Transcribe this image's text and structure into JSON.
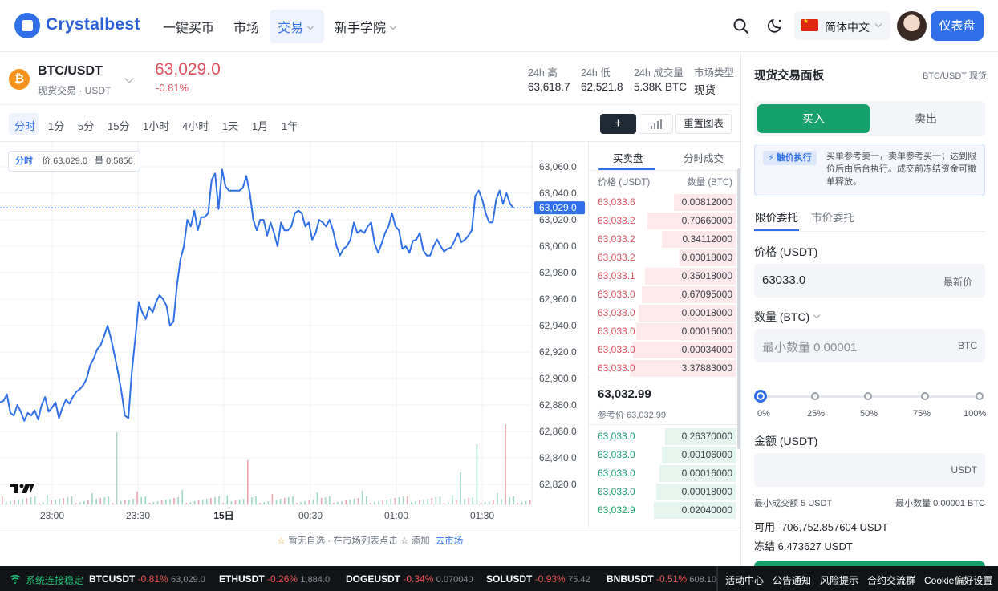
{
  "header": {
    "brand": "Crystalbest",
    "nav": [
      "一键买币",
      "市场",
      "交易",
      "新手学院"
    ],
    "language": "简体中文",
    "dashboard_label": "仪表盘"
  },
  "ticker": {
    "pair": "BTC/USDT",
    "sub": "现货交易 · USDT",
    "price": "63,029.0",
    "change": "-0.81%",
    "stats": [
      {
        "label": "24h 高",
        "value": "63,618.7"
      },
      {
        "label": "24h 低",
        "value": "62,521.8"
      },
      {
        "label": "24h 成交量",
        "value": "5.38K BTC"
      },
      {
        "label": "市场类型",
        "value": "现货"
      }
    ]
  },
  "toolbar": {
    "timeframes": [
      "分时",
      "1分",
      "5分",
      "15分",
      "1小时",
      "4小时",
      "1天",
      "1月",
      "1年"
    ],
    "active": "分时",
    "plus": "+",
    "reset": "重置图表"
  },
  "chart_info": {
    "mode": "分时",
    "price_label": "价",
    "price": "63,029.0",
    "vol_label": "量",
    "vol": "0.5856"
  },
  "chart_data": {
    "type": "line",
    "current_price": 63029.0,
    "current_price_label": "63,029.0",
    "ylim": [
      62805,
      63075
    ],
    "y_ticks": [
      "63,060.0",
      "63,040.0",
      "63,020.0",
      "63,000.0",
      "62,980.0",
      "62,960.0",
      "62,940.0",
      "62,920.0",
      "62,900.0",
      "62,880.0",
      "62,860.0",
      "62,840.0",
      "62,820.0"
    ],
    "x_ticks": [
      "23:00",
      "23:30",
      "15日",
      "00:30",
      "01:00",
      "01:30"
    ],
    "grid": true,
    "series": [
      {
        "values": [
          62882,
          62883,
          62888,
          62874,
          62872,
          62880,
          62875,
          62868,
          62874,
          62872,
          62876,
          62869,
          62880,
          62886,
          62875,
          62878,
          62882,
          62870,
          62878,
          62884,
          62881,
          62886,
          62890,
          62892,
          62895,
          62900,
          62910,
          62915,
          62922,
          62925,
          62932,
          62940,
          62930,
          62918,
          62905,
          62890,
          62872,
          62870,
          62905,
          62930,
          62958,
          62950,
          62945,
          62954,
          62950,
          62958,
          62963,
          62960,
          62955,
          62940,
          62943,
          62970,
          62990,
          63000,
          63020,
          63015,
          63027,
          63012,
          63022,
          63022,
          63025,
          63050,
          63055,
          63028,
          63058,
          63045,
          63042,
          63042,
          63042,
          63042,
          63044,
          63053,
          63040,
          63020,
          63012,
          63020,
          63020,
          63008,
          63018,
          63010,
          63000,
          63018,
          63012,
          63012,
          63015,
          63025,
          63027,
          63025,
          63015,
          63018,
          63005,
          63010,
          63020,
          63018,
          63015,
          63020,
          63012,
          63000,
          62993,
          62998,
          63000,
          63005,
          63018,
          63010,
          63012,
          63010,
          63015,
          63018,
          63002,
          62995,
          63002,
          63010,
          63015,
          63025,
          63015,
          63012,
          62998,
          63000,
          62995,
          63004,
          63005,
          63010,
          62997,
          62993,
          62993,
          63000,
          63005,
          63000,
          62996,
          62998,
          62999,
          63004,
          63010,
          63003,
          63005,
          63008,
          63012,
          63038,
          63042,
          63035,
          63025,
          63018,
          63018,
          63035,
          63042,
          63032,
          63040,
          63032,
          63029
        ]
      }
    ]
  },
  "orderbook": {
    "tabs": [
      "买卖盘",
      "分时成交"
    ],
    "col_price": "价格 (USDT)",
    "col_qty": "数量 (BTC)",
    "asks": [
      {
        "price": "63,033.6",
        "qty": "0.00812000"
      },
      {
        "price": "63,033.2",
        "qty": "0.70660000"
      },
      {
        "price": "63,033.2",
        "qty": "0.34112000"
      },
      {
        "price": "63,033.2",
        "qty": "0.00018000"
      },
      {
        "price": "63,033.1",
        "qty": "0.35018000"
      },
      {
        "price": "63,033.0",
        "qty": "0.67095000"
      },
      {
        "price": "63,033.0",
        "qty": "0.00018000"
      },
      {
        "price": "63,033.0",
        "qty": "0.00016000"
      },
      {
        "price": "63,033.0",
        "qty": "0.00034000"
      },
      {
        "price": "63,033.0",
        "qty": "3.37883000"
      }
    ],
    "ask_depth": [
      0.42,
      0.6,
      0.5,
      0.38,
      0.62,
      0.64,
      0.66,
      0.68,
      0.7,
      0.72
    ],
    "mid_price": "63,032.99",
    "ref_price": "参考价 63,032.99",
    "bids": [
      {
        "price": "63,033.0",
        "qty": "0.26370000"
      },
      {
        "price": "63,033.0",
        "qty": "0.00106000"
      },
      {
        "price": "63,033.0",
        "qty": "0.00016000"
      },
      {
        "price": "63,033.0",
        "qty": "0.00018000"
      },
      {
        "price": "63,032.9",
        "qty": "0.02040000"
      }
    ],
    "bid_depth": [
      0.48,
      0.5,
      0.52,
      0.54,
      0.56
    ]
  },
  "favorites_hint": {
    "text": "暂无自选 · 在市场列表点击 ☆ 添加",
    "link": "去市场"
  },
  "panel": {
    "title": "现货交易面板",
    "pair_tag": "BTC/USDT 现货",
    "buy": "买入",
    "sell": "卖出",
    "badge": "触价执行",
    "notice": "买单参考卖一，卖单参考买一；达到限价后由后台执行。成交前冻结资金可撤单释放。",
    "order_tabs": [
      "限价委托",
      "市价委托"
    ],
    "price_label": "价格 (USDT)",
    "price_value": "63033.0",
    "price_suffix": "最新价",
    "qty_label": "数量 (BTC)",
    "qty_placeholder": "最小数量 0.00001",
    "qty_unit": "BTC",
    "slider_percent": 0,
    "percents": [
      "0%",
      "25%",
      "50%",
      "75%",
      "100%"
    ],
    "amount_label": "金额 (USDT)",
    "amount_unit": "USDT",
    "min_trade": "最小成交额 5 USDT",
    "min_qty": "最小数量 0.00001 BTC",
    "available": "可用 -706,752.857604 USDT",
    "frozen": "冻结 6.473627 USDT"
  },
  "footer": {
    "status": "系统连接稳定",
    "tickers": [
      {
        "sym": "BTCUSDT",
        "chg": "-0.81%",
        "price": "63,029.0"
      },
      {
        "sym": "ETHUSDT",
        "chg": "-0.26%",
        "price": "1,884.0"
      },
      {
        "sym": "DOGEUSDT",
        "chg": "-0.34%",
        "price": "0.070040"
      },
      {
        "sym": "SOLUSDT",
        "chg": "-0.93%",
        "price": "75.42"
      },
      {
        "sym": "BNBUSDT",
        "chg": "-0.51%",
        "price": "608.10"
      }
    ],
    "links": [
      "活动中心",
      "公告通知",
      "风险提示",
      "合约交流群",
      "Cookie偏好设置"
    ]
  },
  "colors": {
    "accent": "#2f6fe8",
    "buy": "#16a06b",
    "sell": "#e0505d",
    "line": "#2f6fe8"
  }
}
